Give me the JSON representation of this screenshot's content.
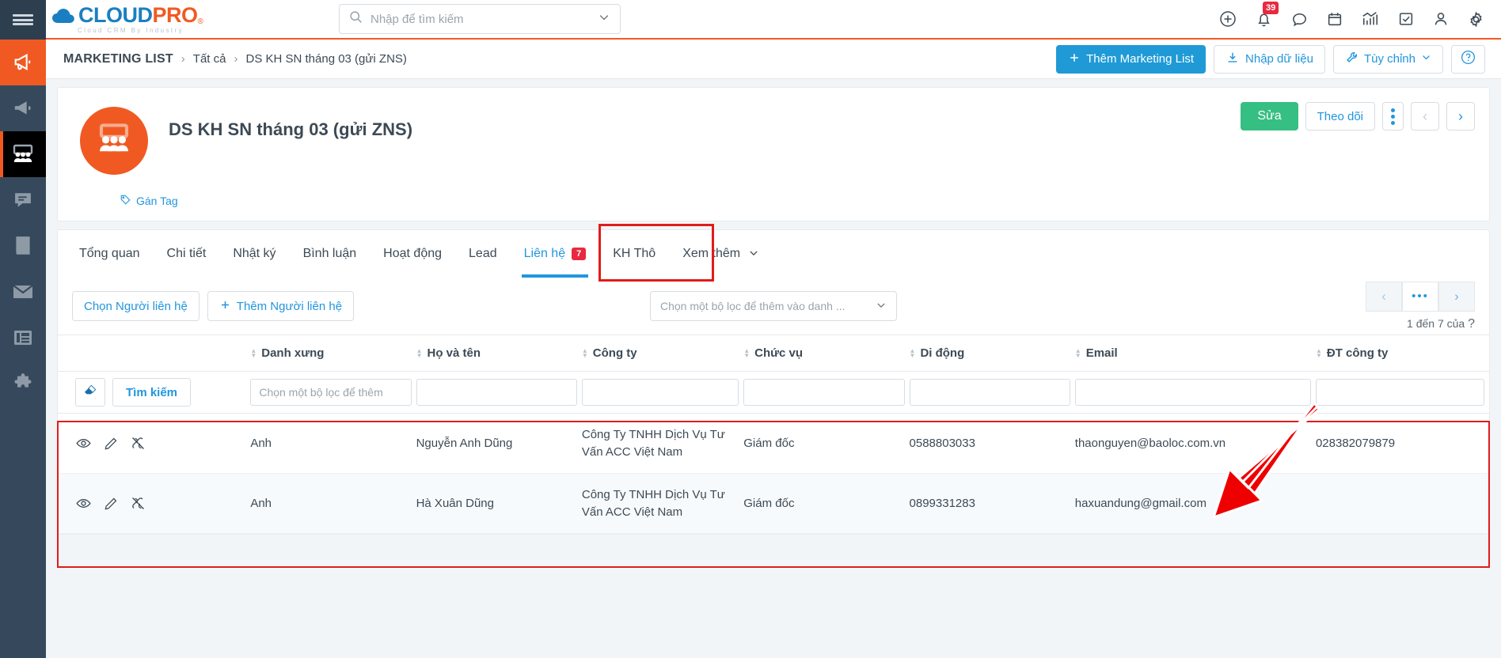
{
  "sidebar": {
    "menu_icon": "hamburger-icon",
    "items": [
      {
        "name": "megaphone-icon",
        "state": "active-orange"
      },
      {
        "name": "megaphone-alt-icon",
        "state": "normal"
      },
      {
        "name": "group-people-icon",
        "state": "active-dark"
      },
      {
        "name": "chat-bubble-icon",
        "state": "normal"
      },
      {
        "name": "book-icon",
        "state": "normal"
      },
      {
        "name": "envelope-icon",
        "state": "normal"
      },
      {
        "name": "newspaper-icon",
        "state": "normal"
      },
      {
        "name": "puzzle-icon",
        "state": "normal"
      }
    ]
  },
  "topbar": {
    "logo_cloud": "CLOUD",
    "logo_pro": "PRO",
    "logo_reg": "®",
    "logo_tagline": "Cloud CRM By Industry",
    "search_placeholder": "Nhập để tìm kiếm",
    "search_value": "",
    "icons": [
      {
        "name": "plus-circle-icon"
      },
      {
        "name": "bell-icon",
        "badge": "39"
      },
      {
        "name": "chat-icon"
      },
      {
        "name": "calendar-icon"
      },
      {
        "name": "analytics-icon"
      },
      {
        "name": "task-check-icon"
      },
      {
        "name": "user-icon"
      },
      {
        "name": "gear-icon"
      }
    ]
  },
  "breadcrumb": {
    "root": "MARKETING LIST",
    "sep": "›",
    "level2": "Tất cả",
    "current": "DS KH SN tháng 03 (gửi ZNS)",
    "add_button": "Thêm Marketing List",
    "import_button": "Nhập dữ liệu",
    "customize_button": "Tùy chỉnh",
    "help_button": "?"
  },
  "record": {
    "title": "DS KH SN tháng 03 (gửi ZNS)",
    "tag_link": "Gán Tag",
    "edit_button": "Sửa",
    "follow_button": "Theo dõi",
    "more_button": "more-vertical-icon",
    "prev_button": "‹",
    "next_button": "›"
  },
  "tabs": [
    {
      "label": "Tổng quan",
      "active": false
    },
    {
      "label": "Chi tiết",
      "active": false
    },
    {
      "label": "Nhật ký",
      "active": false
    },
    {
      "label": "Bình luận",
      "active": false
    },
    {
      "label": "Hoạt động",
      "active": false
    },
    {
      "label": "Lead",
      "active": false
    },
    {
      "label": "Liên hệ",
      "count": "7",
      "active": true
    },
    {
      "label": "KH Thô",
      "active": false
    },
    {
      "label": "Xem thêm",
      "active": false,
      "chevron": true
    }
  ],
  "toolbar": {
    "choose_contact_button": "Chọn Người liên hệ",
    "add_contact_button": "Thêm Người liên hệ",
    "filter_placeholder": "Chọn một bộ lọc để thêm vào danh ...",
    "pager_prev": "‹",
    "pager_more": "•••",
    "pager_next": "›",
    "pager_info": "1 đến 7 của",
    "pager_total": "?"
  },
  "table": {
    "columns": [
      {
        "label": "",
        "key": "actions"
      },
      {
        "label": "Danh xưng",
        "key": "danh_xung"
      },
      {
        "label": "Họ và tên",
        "key": "ho_va_ten"
      },
      {
        "label": "Công ty",
        "key": "cong_ty"
      },
      {
        "label": "Chức vụ",
        "key": "chuc_vu"
      },
      {
        "label": "Di động",
        "key": "di_dong"
      },
      {
        "label": "Email",
        "key": "email"
      },
      {
        "label": "ĐT công ty",
        "key": "dt_cong_ty"
      }
    ],
    "filter_row": {
      "eraser_icon": "eraser-icon",
      "search_button": "Tìm kiếm",
      "danh_xung_placeholder": "Chọn một bộ lọc để thêm",
      "ho_va_ten_value": "",
      "cong_ty_value": "",
      "chuc_vu_value": "",
      "di_dong_value": "",
      "email_value": "",
      "dt_cong_ty_value": ""
    },
    "rows": [
      {
        "actions": [
          "eye-icon",
          "pencil-icon",
          "unlink-icon"
        ],
        "danh_xung": "Anh",
        "ho_va_ten": "Nguyễn Anh Dũng",
        "cong_ty": "Công Ty TNHH Dịch Vụ Tư Vấn ACC Việt Nam",
        "chuc_vu": "Giám đốc",
        "di_dong": "0588803033",
        "email": "thaonguyen@baoloc.com.vn",
        "dt_cong_ty": "028382079879"
      },
      {
        "actions": [
          "eye-icon",
          "pencil-icon",
          "unlink-icon"
        ],
        "danh_xung": "Anh",
        "ho_va_ten": "Hà Xuân Dũng",
        "cong_ty": "Công Ty TNHH Dịch Vụ Tư Vấn ACC Việt Nam",
        "chuc_vu": "Giám đốc",
        "di_dong": "0899331283",
        "email": "haxuandung@gmail.com",
        "dt_cong_ty": ""
      }
    ]
  },
  "annotations": {
    "tab_highlight_color": "#e21b1b",
    "rows_highlight_color": "#e21b1b",
    "arrow_color": "#ee0000"
  },
  "colors": {
    "brand_orange": "#f05a22",
    "brand_blue": "#1a7fc1",
    "accent_blue": "#2196dd",
    "green": "#36bf83",
    "badge_red": "#e8293f",
    "sidebar": "#36495c"
  }
}
